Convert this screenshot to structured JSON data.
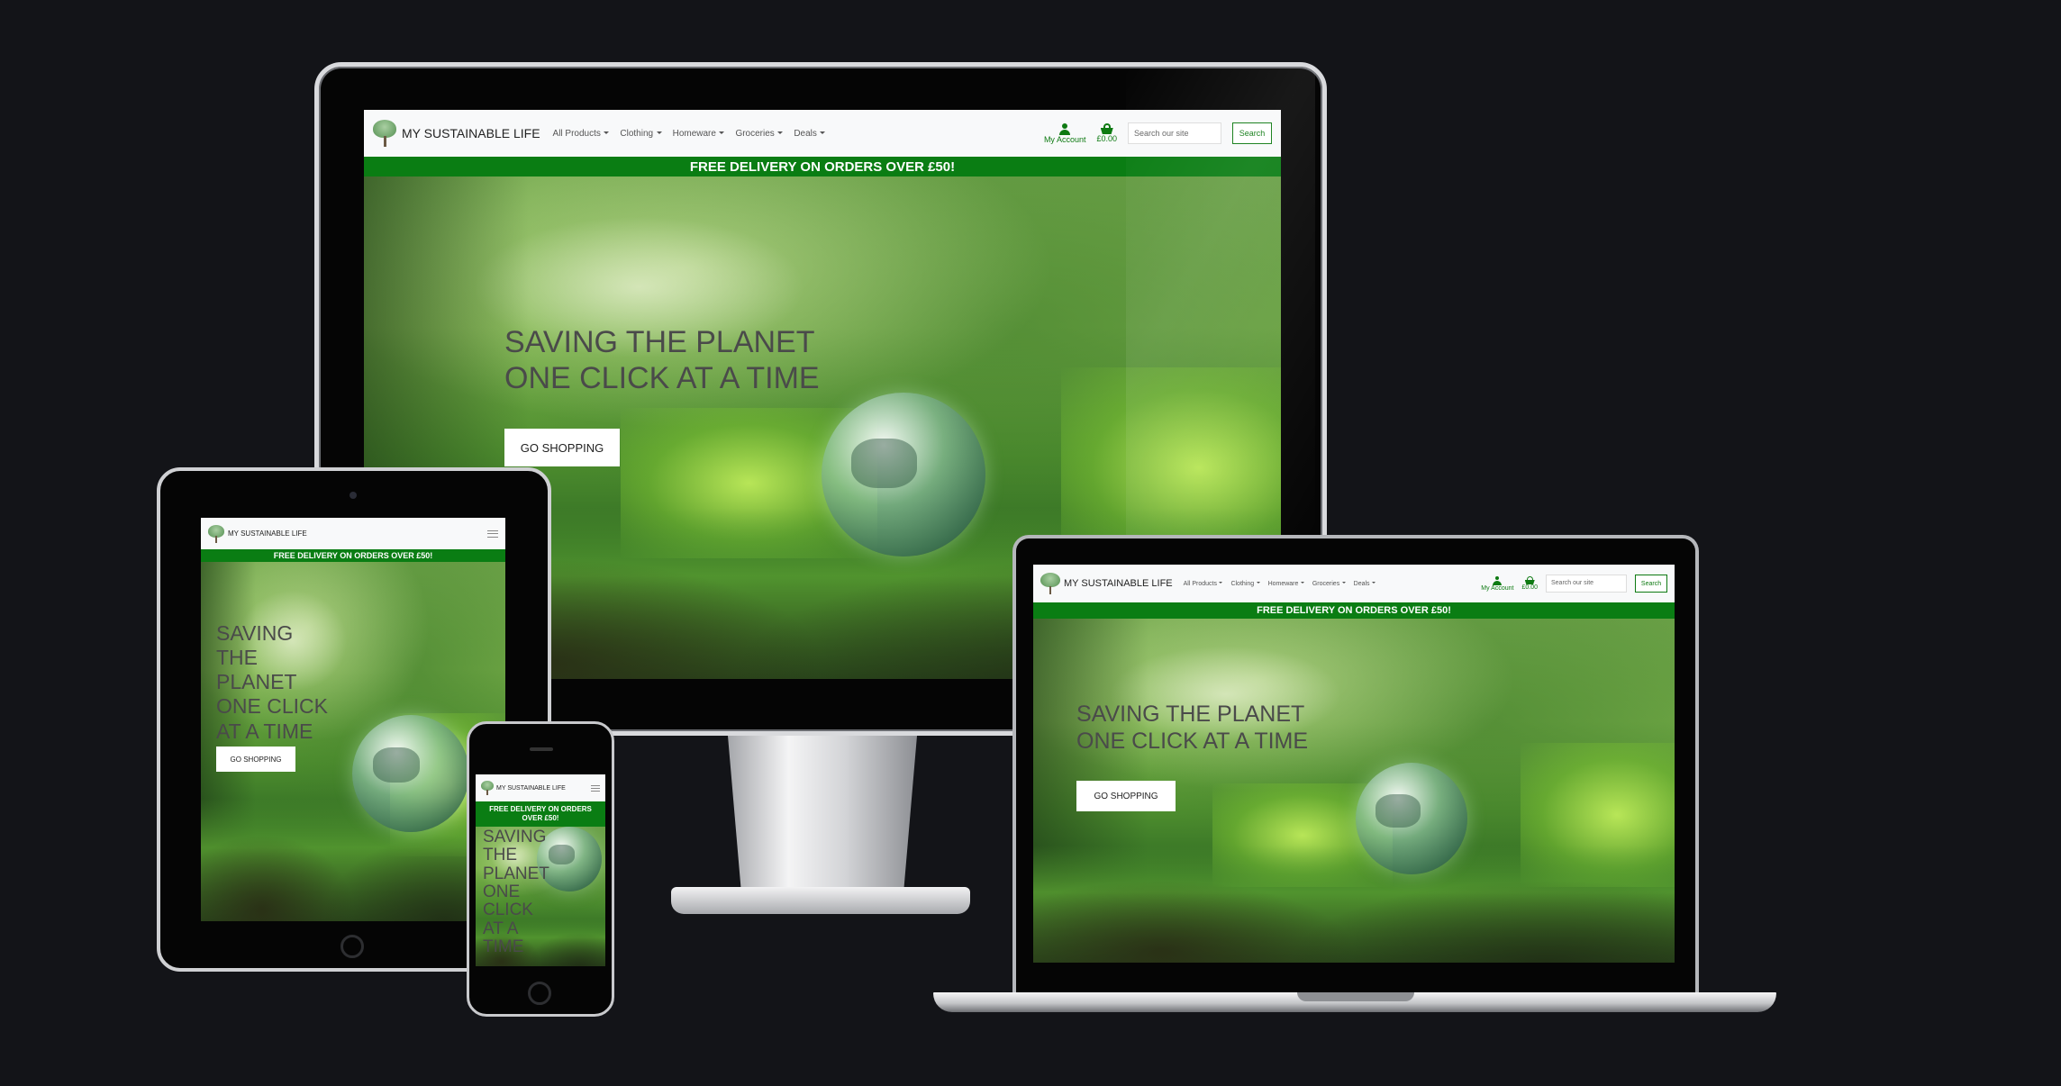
{
  "site": {
    "brand": "MY SUSTAINABLE LIFE",
    "nav": [
      "All Products",
      "Clothing",
      "Homeware",
      "Groceries",
      "Deals"
    ],
    "account_label": "My Account",
    "basket_total": "£0.00",
    "search_placeholder": "Search our site",
    "search_button": "Search",
    "banner": "FREE DELIVERY ON ORDERS OVER £50!",
    "hero_title": "SAVING THE PLANET ONE CLICK AT A TIME",
    "hero_button": "GO SHOPPING"
  },
  "colors": {
    "background": "#131418",
    "brand_green": "#0a7d13",
    "nav_background": "#f8f9fa"
  },
  "icons": [
    "tree-logo-icon",
    "user-icon",
    "basket-icon",
    "hamburger-menu-icon",
    "chevron-down-icon"
  ]
}
